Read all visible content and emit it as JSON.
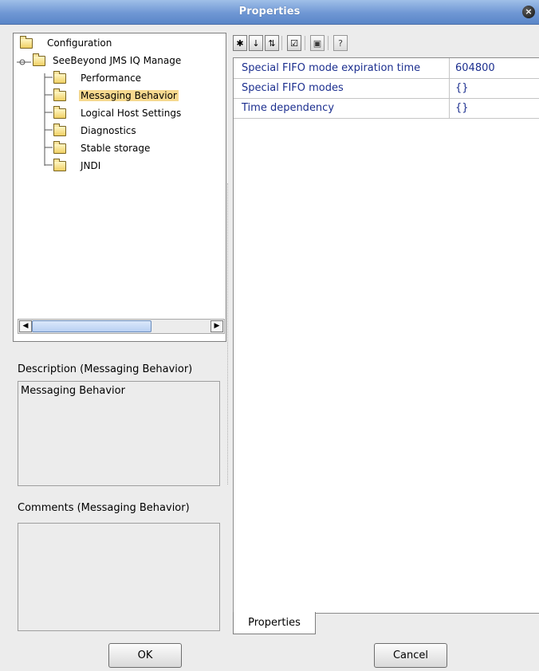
{
  "window": {
    "title": "Properties"
  },
  "toolbar": {
    "icons": [
      "categorized-icon",
      "sort-alpha-icon",
      "sort-type-icon",
      "checklist-icon",
      "window-icon",
      "help-icon"
    ]
  },
  "tree": {
    "root": "Configuration",
    "manager": "SeeBeyond JMS IQ Manage",
    "children": [
      "Performance",
      "Messaging Behavior",
      "Logical Host Settings",
      "Diagnostics",
      "Stable storage",
      "JNDI"
    ],
    "selected": "Messaging Behavior"
  },
  "description": {
    "title": "Description (Messaging Behavior)",
    "text": "Messaging Behavior"
  },
  "comments": {
    "title": "Comments (Messaging Behavior)",
    "text": ""
  },
  "properties": [
    {
      "name": "Special FIFO mode expiration time",
      "value": "604800"
    },
    {
      "name": "Special FIFO modes",
      "value": "{}"
    },
    {
      "name": "Time dependency",
      "value": "{}"
    }
  ],
  "tabs": [
    "Properties"
  ],
  "buttons": {
    "ok": "OK",
    "cancel": "Cancel"
  },
  "colors": {
    "title_bar": "#6f97d4",
    "selected": "#f6d98f",
    "property_text": "#1c2f8f"
  }
}
